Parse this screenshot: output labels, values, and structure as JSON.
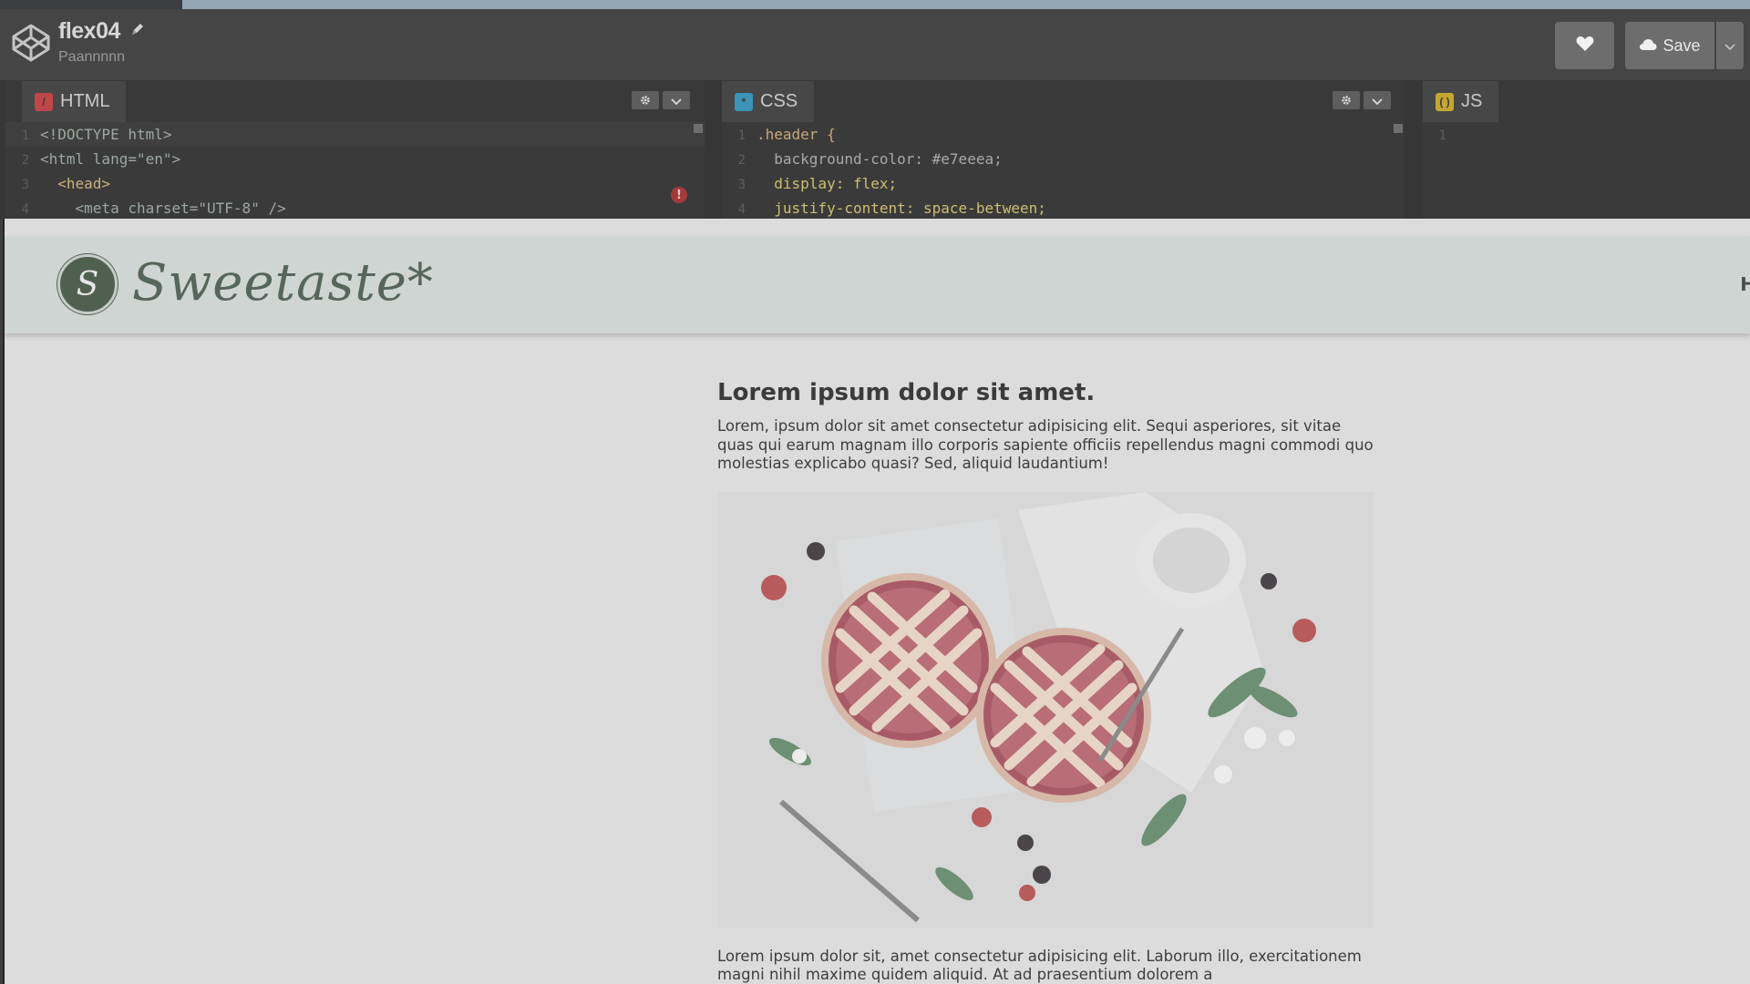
{
  "app": {
    "pen_title": "flex04",
    "author": "Paannnnn",
    "save_label": "Save",
    "colors": {
      "topbar": "#454545",
      "editor_bg": "#3a3a3a",
      "preview_bg": "#dcdcdc"
    }
  },
  "editors": {
    "html": {
      "label": "HTML",
      "icon": "html-icon",
      "lines": [
        {
          "n": "1",
          "text": "<!DOCTYPE html>"
        },
        {
          "n": "2",
          "text": "<html lang=\"en\">"
        },
        {
          "n": "3",
          "text": "  <head>"
        },
        {
          "n": "4",
          "text": "    <meta charset=\"UTF-8\" />"
        }
      ],
      "error_marker": "!"
    },
    "css": {
      "label": "CSS",
      "icon": "css-icon",
      "lines": [
        {
          "n": "1",
          "text": ".header {"
        },
        {
          "n": "2",
          "text": "  background-color: #e7eeea;"
        },
        {
          "n": "3",
          "text": "  display: flex;"
        },
        {
          "n": "4",
          "text": "  justify-content: space-between;"
        }
      ]
    },
    "js": {
      "label": "JS",
      "icon": "js-icon",
      "lines": [
        {
          "n": "1",
          "text": ""
        }
      ]
    }
  },
  "preview": {
    "logo_mark": "S",
    "logo_text": "Sweetaste*",
    "nav_first_letter": "H",
    "heading": "Lorem ipsum dolor sit amet.",
    "intro": "Lorem, ipsum dolor sit amet consectetur adipisicing elit. Sequi asperiores, sit vitae quas qui earum magnam illo corporis sapiente officiis repellendus magni commodi quo molestias explicabo quasi? Sed, aliquid laudantium!",
    "body": "Lorem ipsum dolor sit, amet consectetur adipisicing elit. Laborum illo, exercitationem magni nihil maxime quidem aliquid. At ad praesentium dolorem a"
  }
}
